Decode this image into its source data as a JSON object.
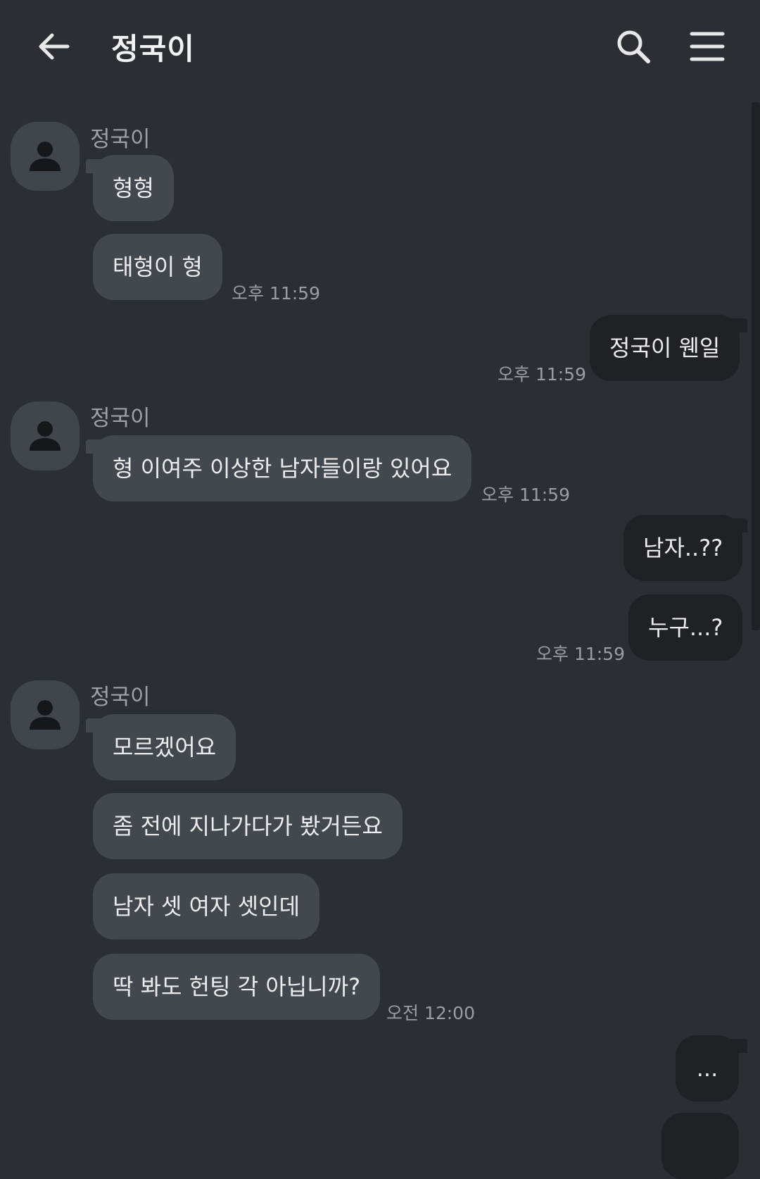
{
  "header": {
    "title": "정국이",
    "back_icon": "arrow-left-icon",
    "search_icon": "search-icon",
    "menu_icon": "menu-icon"
  },
  "messages": [
    {
      "sender": "정국이",
      "text": "형형"
    },
    {
      "text": "태형이 형",
      "time": "오후 11:59"
    },
    {
      "text": "정국이 웬일",
      "time": "오후 11:59"
    },
    {
      "sender": "정국이",
      "text": "형 이여주 이상한 남자들이랑 있어요",
      "time": "오후 11:59"
    },
    {
      "text": "남자..??"
    },
    {
      "text": "누구...?",
      "time": "오후 11:59"
    },
    {
      "sender": "정국이",
      "text": "모르겠어요"
    },
    {
      "text": "좀 전에 지나가다가 봤거든요"
    },
    {
      "text": "남자 셋 여자 셋인데"
    },
    {
      "text": "딱 봐도 헌팅 각 아닙니까?",
      "time": "오전 12:00"
    },
    {
      "text": "..."
    }
  ],
  "colors": {
    "background": "#2b2e33",
    "incoming_bubble": "#43474e",
    "outgoing_bubble": "#1f2125"
  }
}
